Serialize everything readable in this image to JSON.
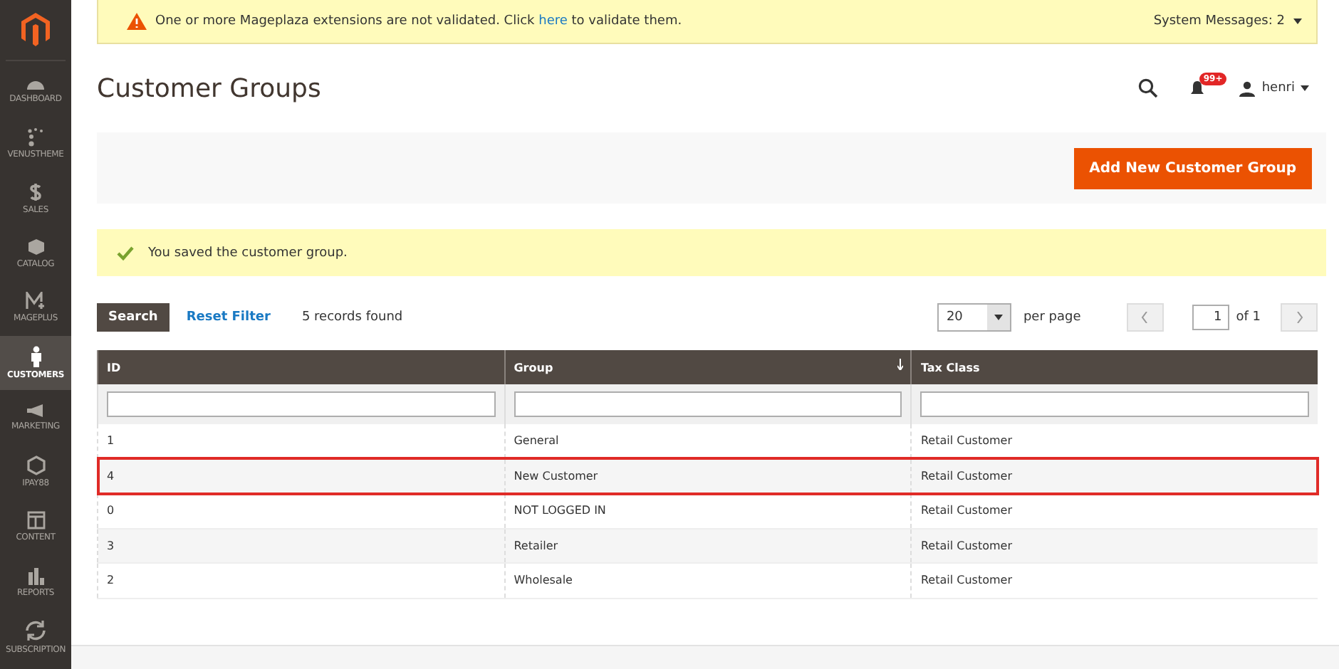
{
  "sidebar": {
    "items": [
      {
        "label": "DASHBOARD",
        "kind": "gauge",
        "selected": false
      },
      {
        "label": "VENUSTHEME",
        "kind": "dots",
        "selected": false
      },
      {
        "label": "SALES",
        "kind": "dollar",
        "selected": false
      },
      {
        "label": "CATALOG",
        "kind": "box",
        "selected": false
      },
      {
        "label": "MAGEPLUS",
        "kind": "mplus",
        "selected": false
      },
      {
        "label": "CUSTOMERS",
        "kind": "person",
        "selected": true
      },
      {
        "label": "MARKETING",
        "kind": "megaphone",
        "selected": false
      },
      {
        "label": "IPAY88",
        "kind": "hexagon",
        "selected": false
      },
      {
        "label": "CONTENT",
        "kind": "layout",
        "selected": false
      },
      {
        "label": "REPORTS",
        "kind": "bars",
        "selected": false
      },
      {
        "label": "SUBSCRIPTION",
        "kind": "sync",
        "selected": false
      }
    ]
  },
  "system_message": {
    "text_before": "One or more Mageplaza extensions are not validated. Click",
    "link": "here",
    "text_after": "to validate them.",
    "summary": "System Messages: 2"
  },
  "header": {
    "title": "Customer Groups",
    "notifications": "99+",
    "user": "henri"
  },
  "actions": {
    "primary": "Add New Customer Group"
  },
  "success_message": "You saved the customer group.",
  "grid_toolbar": {
    "search": "Search",
    "reset": "Reset Filter",
    "records": "5 records found",
    "per_page_value": "20",
    "per_page_label": "per page",
    "page": "1",
    "of_pages": "of 1"
  },
  "table": {
    "columns": [
      {
        "label": "ID",
        "sorted": false
      },
      {
        "label": "Group",
        "sorted": true
      },
      {
        "label": "Tax Class",
        "sorted": false
      }
    ],
    "rows": [
      {
        "cells": [
          "1",
          "General",
          "Retail Customer"
        ],
        "highlighted": false
      },
      {
        "cells": [
          "4",
          "New Customer",
          "Retail Customer"
        ],
        "highlighted": true
      },
      {
        "cells": [
          "0",
          "NOT LOGGED IN",
          "Retail Customer"
        ],
        "highlighted": false
      },
      {
        "cells": [
          "3",
          "Retailer",
          "Retail Customer"
        ],
        "highlighted": false
      },
      {
        "cells": [
          "2",
          "Wholesale",
          "Retail Customer"
        ],
        "highlighted": false
      }
    ]
  }
}
